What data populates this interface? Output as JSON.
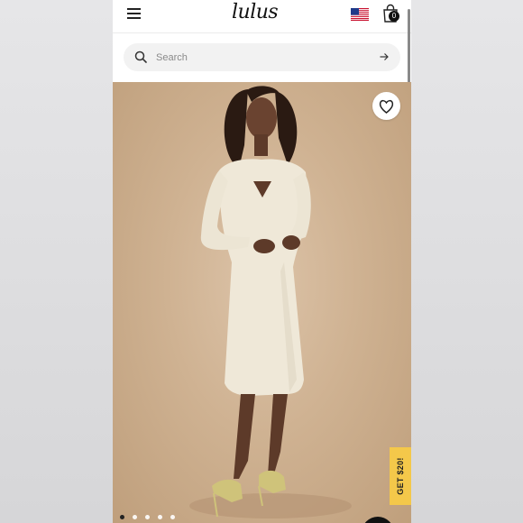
{
  "header": {
    "logo_text": "lulus",
    "menu_icon": "hamburger-menu-icon",
    "flag_icon": "us-flag-icon",
    "bag_icon": "shopping-bag-icon",
    "bag_count": "0"
  },
  "search": {
    "placeholder": "Search",
    "search_icon": "search-icon",
    "submit_icon": "arrow-right-icon"
  },
  "product_gallery": {
    "photo_description_icon": "model-in-cream-sweater-dress-photo",
    "wishlist_icon": "heart-icon",
    "carousel_dots": 5,
    "active_dot": 1,
    "chat_icon": "chat-bubble-icon"
  },
  "promo": {
    "label": "GET $20!"
  },
  "colors": {
    "accent_promo": "#f4c84a",
    "photo_background": "#cfb292",
    "dress": "#efe8d8"
  }
}
